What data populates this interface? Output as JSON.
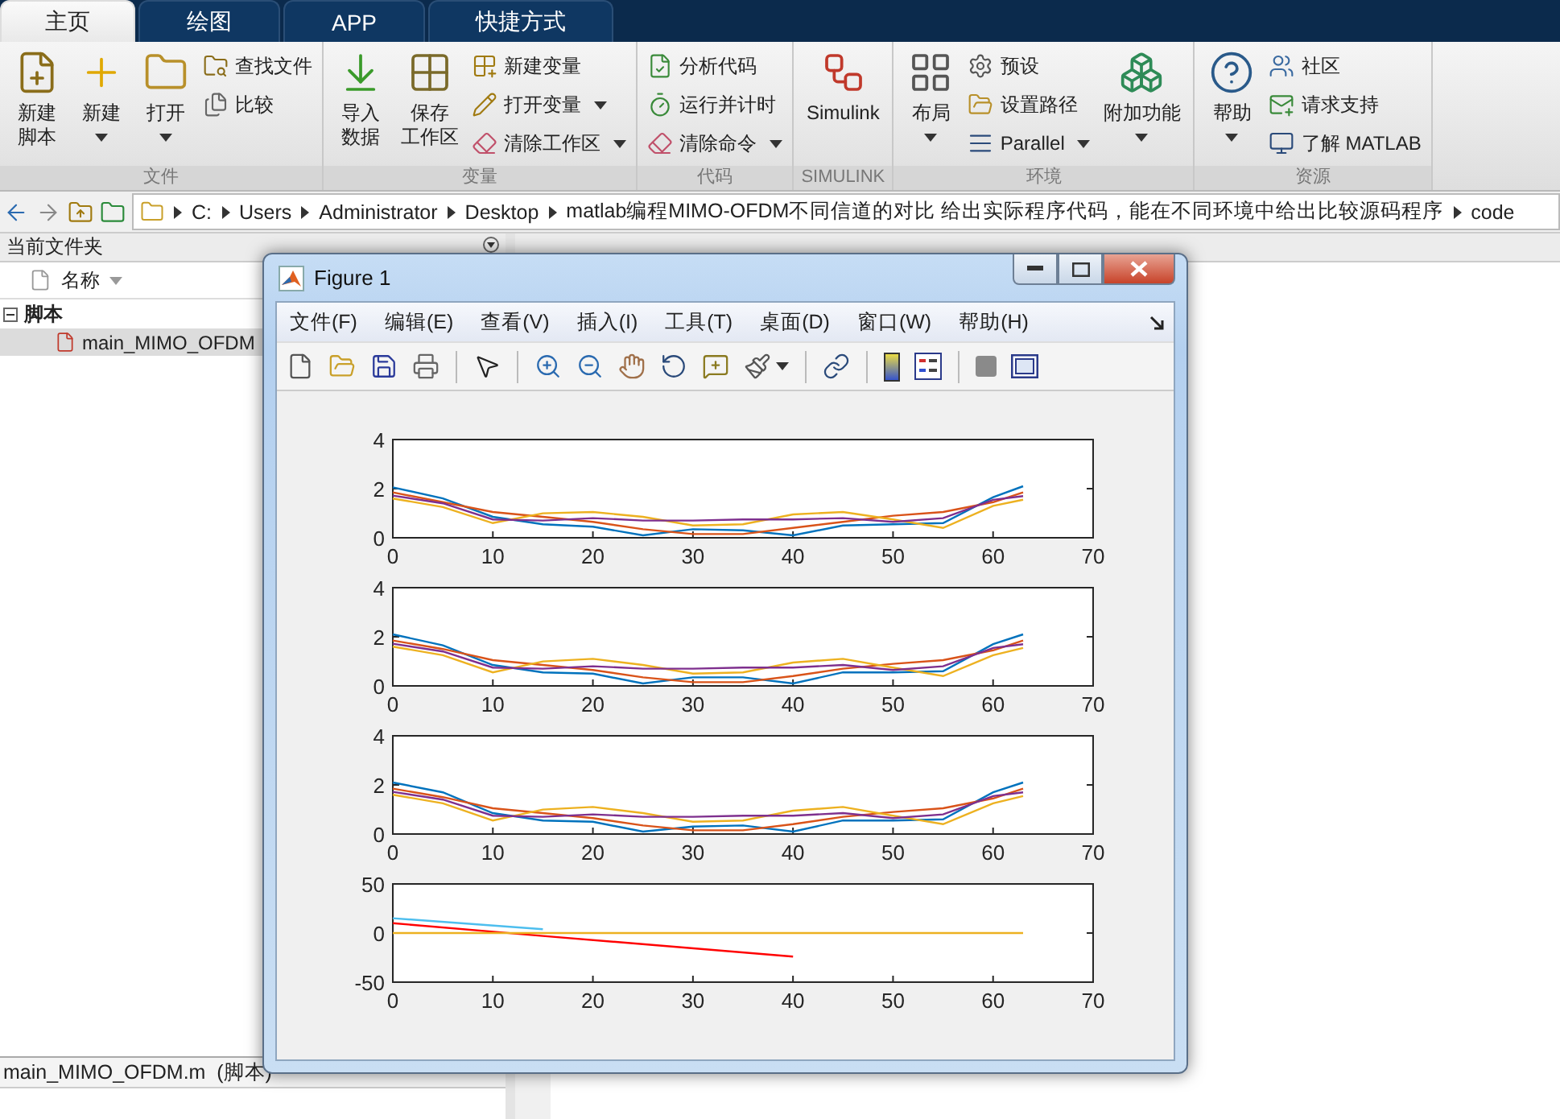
{
  "tabs": [
    {
      "label": "主页",
      "selected": true
    },
    {
      "label": "绘图",
      "selected": false
    },
    {
      "label": "APP",
      "selected": false
    },
    {
      "label": "快捷方式",
      "selected": false
    }
  ],
  "ribbon": {
    "groups": [
      {
        "title": "文件",
        "items": [
          {
            "kind": "large",
            "lines": [
              "新建",
              "脚本"
            ],
            "dropdown": false
          },
          {
            "kind": "large",
            "lines": [
              "新建"
            ],
            "dropdown": true
          },
          {
            "kind": "large",
            "lines": [
              "打开"
            ],
            "dropdown": true
          },
          {
            "kind": "stack",
            "items": [
              {
                "label": "查找文件",
                "dropdown": false
              },
              {
                "label": "比较",
                "dropdown": false
              }
            ]
          }
        ]
      },
      {
        "title": "变量",
        "items": [
          {
            "kind": "large",
            "lines": [
              "导入",
              "数据"
            ],
            "dropdown": false
          },
          {
            "kind": "large",
            "lines": [
              "保存",
              "工作区"
            ],
            "dropdown": false
          },
          {
            "kind": "stack",
            "items": [
              {
                "label": "新建变量",
                "dropdown": false
              },
              {
                "label": "打开变量",
                "dropdown": true
              },
              {
                "label": "清除工作区",
                "dropdown": true
              }
            ]
          }
        ]
      },
      {
        "title": "代码",
        "items": [
          {
            "kind": "stack",
            "items": [
              {
                "label": "分析代码",
                "dropdown": false
              },
              {
                "label": "运行并计时",
                "dropdown": false
              },
              {
                "label": "清除命令",
                "dropdown": true
              }
            ]
          }
        ]
      },
      {
        "title": "SIMULINK",
        "items": [
          {
            "kind": "large",
            "lines": [
              "Simulink"
            ],
            "dropdown": false
          }
        ]
      },
      {
        "title": "环境",
        "items": [
          {
            "kind": "large",
            "lines": [
              "布局"
            ],
            "dropdown": true
          },
          {
            "kind": "stack",
            "items": [
              {
                "label": "预设",
                "dropdown": false
              },
              {
                "label": "设置路径",
                "dropdown": false
              },
              {
                "label": "Parallel",
                "dropdown": true
              }
            ]
          },
          {
            "kind": "large",
            "lines": [
              "附加功能"
            ],
            "dropdown": true
          }
        ]
      },
      {
        "title": "资源",
        "items": [
          {
            "kind": "large",
            "lines": [
              "帮助"
            ],
            "dropdown": true
          },
          {
            "kind": "stack",
            "items": [
              {
                "label": "社区",
                "dropdown": false
              },
              {
                "label": "请求支持",
                "dropdown": false
              },
              {
                "label": "了解 MATLAB",
                "dropdown": false
              }
            ]
          }
        ]
      }
    ]
  },
  "path": [
    "C:",
    "Users",
    "Administrator",
    "Desktop",
    "matlab编程MIMO-OFDM不同信道的对比 给出实际程序代码，能在不同环境中给出比较源码程序",
    "code"
  ],
  "current_folder": {
    "title": "当前文件夹",
    "column": "名称",
    "group": "脚本",
    "files": [
      {
        "name": "main_MIMO_OFDM",
        "selected": true
      }
    ],
    "details": "main_MIMO_OFDM.m  (脚本)"
  },
  "figure": {
    "title": "Figure 1",
    "menu": [
      "文件(F)",
      "编辑(E)",
      "查看(V)",
      "插入(I)",
      "工具(T)",
      "桌面(D)",
      "窗口(W)",
      "帮助(H)"
    ],
    "plots": [
      {
        "chart_data": {
          "type": "line",
          "x": [
            0,
            5,
            10,
            15,
            20,
            25,
            30,
            35,
            40,
            45,
            50,
            55,
            60,
            63
          ],
          "xlim": [
            0,
            70
          ],
          "ylim": [
            0,
            4
          ],
          "xticks": [
            0,
            10,
            20,
            30,
            40,
            50,
            60,
            70
          ],
          "yticks": [
            0,
            2,
            4
          ],
          "series": [
            {
              "color": "#0072bd",
              "values": [
                2.05,
                1.6,
                0.85,
                0.55,
                0.45,
                0.1,
                0.35,
                0.3,
                0.1,
                0.5,
                0.55,
                0.6,
                1.65,
                2.1
              ]
            },
            {
              "color": "#d95319",
              "values": [
                1.85,
                1.45,
                1.05,
                0.85,
                0.65,
                0.35,
                0.15,
                0.15,
                0.4,
                0.65,
                0.9,
                1.05,
                1.45,
                1.85
              ]
            },
            {
              "color": "#edb120",
              "values": [
                1.6,
                1.25,
                0.6,
                1.0,
                1.05,
                0.85,
                0.5,
                0.55,
                0.95,
                1.05,
                0.75,
                0.4,
                1.3,
                1.55
              ]
            },
            {
              "color": "#7e2f8e",
              "values": [
                1.72,
                1.4,
                0.75,
                0.7,
                0.8,
                0.7,
                0.7,
                0.75,
                0.75,
                0.8,
                0.65,
                0.8,
                1.55,
                1.7
              ]
            }
          ]
        }
      },
      {
        "chart_data": {
          "type": "line",
          "x": [
            0,
            5,
            10,
            15,
            20,
            25,
            30,
            35,
            40,
            45,
            50,
            55,
            60,
            63
          ],
          "xlim": [
            0,
            70
          ],
          "ylim": [
            0,
            4
          ],
          "xticks": [
            0,
            10,
            20,
            30,
            40,
            50,
            60,
            70
          ],
          "yticks": [
            0,
            2,
            4
          ],
          "series": [
            {
              "color": "#0072bd",
              "values": [
                2.1,
                1.65,
                0.85,
                0.55,
                0.5,
                0.1,
                0.35,
                0.35,
                0.1,
                0.55,
                0.55,
                0.6,
                1.7,
                2.1
              ]
            },
            {
              "color": "#d95319",
              "values": [
                1.85,
                1.5,
                1.05,
                0.85,
                0.65,
                0.35,
                0.15,
                0.15,
                0.4,
                0.7,
                0.9,
                1.05,
                1.45,
                1.85
              ]
            },
            {
              "color": "#edb120",
              "values": [
                1.6,
                1.25,
                0.55,
                1.0,
                1.1,
                0.85,
                0.5,
                0.55,
                0.95,
                1.1,
                0.75,
                0.4,
                1.25,
                1.55
              ]
            },
            {
              "color": "#7e2f8e",
              "values": [
                1.72,
                1.4,
                0.75,
                0.7,
                0.8,
                0.7,
                0.7,
                0.75,
                0.75,
                0.85,
                0.65,
                0.8,
                1.55,
                1.7
              ]
            }
          ]
        }
      },
      {
        "chart_data": {
          "type": "line",
          "x": [
            0,
            5,
            10,
            15,
            20,
            25,
            30,
            35,
            40,
            45,
            50,
            55,
            60,
            63
          ],
          "xlim": [
            0,
            70
          ],
          "ylim": [
            0,
            4
          ],
          "xticks": [
            0,
            10,
            20,
            30,
            40,
            50,
            60,
            70
          ],
          "yticks": [
            0,
            2,
            4
          ],
          "series": [
            {
              "color": "#0072bd",
              "values": [
                2.1,
                1.7,
                0.85,
                0.55,
                0.5,
                0.1,
                0.3,
                0.35,
                0.1,
                0.55,
                0.55,
                0.6,
                1.7,
                2.1
              ]
            },
            {
              "color": "#d95319",
              "values": [
                1.85,
                1.5,
                1.05,
                0.85,
                0.65,
                0.35,
                0.15,
                0.15,
                0.4,
                0.7,
                0.9,
                1.05,
                1.45,
                1.85
              ]
            },
            {
              "color": "#edb120",
              "values": [
                1.6,
                1.25,
                0.55,
                1.0,
                1.1,
                0.85,
                0.5,
                0.55,
                0.95,
                1.1,
                0.75,
                0.4,
                1.25,
                1.55
              ]
            },
            {
              "color": "#7e2f8e",
              "values": [
                1.72,
                1.4,
                0.75,
                0.7,
                0.8,
                0.7,
                0.7,
                0.75,
                0.75,
                0.85,
                0.65,
                0.8,
                1.55,
                1.7
              ]
            }
          ]
        }
      },
      {
        "chart_data": {
          "type": "line",
          "x": [
            0,
            15,
            40,
            63
          ],
          "xlim": [
            0,
            70
          ],
          "ylim": [
            -50,
            50
          ],
          "xticks": [
            0,
            10,
            20,
            30,
            40,
            50,
            60,
            70
          ],
          "yticks": [
            -50,
            0,
            50
          ],
          "series": [
            {
              "color": "#4dbeee",
              "values": [
                15,
                4,
                null,
                null
              ]
            },
            {
              "color": "#ff0000",
              "values": [
                10,
                -3,
                -24,
                null
              ]
            },
            {
              "color": "#edb120",
              "values": [
                0,
                0,
                0,
                0
              ]
            }
          ]
        }
      }
    ]
  }
}
